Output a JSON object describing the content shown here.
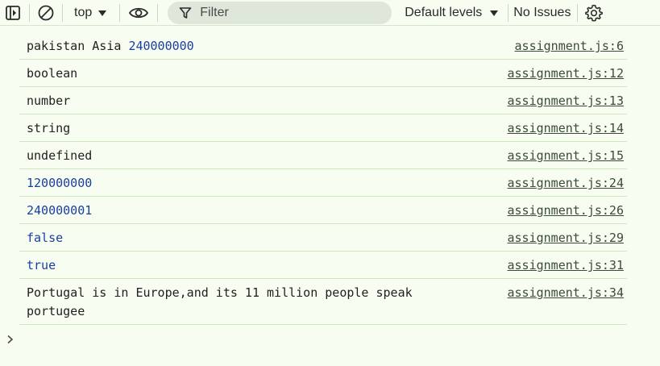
{
  "toolbar": {
    "context": "top",
    "filter_placeholder": "Filter",
    "levels": "Default levels",
    "issues": "No Issues"
  },
  "colors": {
    "background": "#f7fdf1",
    "row_border": "#cbe8c0",
    "number_value": "#1a3fa0",
    "filter_bg": "#dfe7da"
  },
  "icons": {
    "sidebar_toggle": "sidebar-toggle-icon",
    "clear": "clear-console-icon",
    "eye": "live-expression-eye-icon",
    "filter": "filter-funnel-icon",
    "settings": "gear-icon",
    "prompt": "chevron-right-icon"
  },
  "logs": [
    {
      "parts": [
        {
          "t": "pakistan Asia ",
          "k": "str"
        },
        {
          "t": "240000000",
          "k": "num"
        }
      ],
      "source": "assignment.js:6"
    },
    {
      "parts": [
        {
          "t": "boolean",
          "k": "str"
        }
      ],
      "source": "assignment.js:12"
    },
    {
      "parts": [
        {
          "t": "number",
          "k": "str"
        }
      ],
      "source": "assignment.js:13"
    },
    {
      "parts": [
        {
          "t": "string",
          "k": "str"
        }
      ],
      "source": "assignment.js:14"
    },
    {
      "parts": [
        {
          "t": "undefined",
          "k": "str"
        }
      ],
      "source": "assignment.js:15"
    },
    {
      "parts": [
        {
          "t": "120000000",
          "k": "num"
        }
      ],
      "source": "assignment.js:24"
    },
    {
      "parts": [
        {
          "t": "240000001",
          "k": "num"
        }
      ],
      "source": "assignment.js:26"
    },
    {
      "parts": [
        {
          "t": "false",
          "k": "bool"
        }
      ],
      "source": "assignment.js:29"
    },
    {
      "parts": [
        {
          "t": "true",
          "k": "bool"
        }
      ],
      "source": "assignment.js:31"
    },
    {
      "parts": [
        {
          "t": "Portugal is in Europe,and its 11 million people speak portugee",
          "k": "str"
        }
      ],
      "source": "assignment.js:34"
    }
  ]
}
